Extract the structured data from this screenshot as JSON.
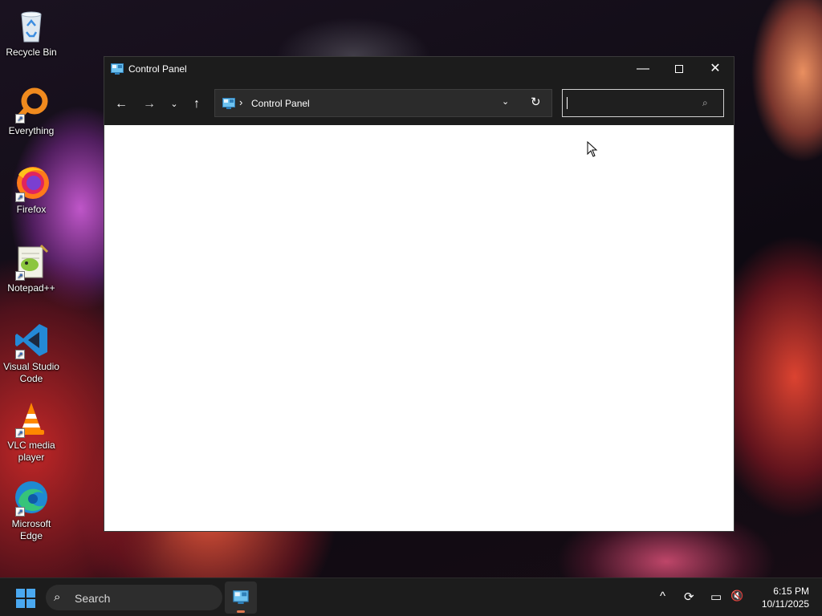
{
  "desktop": {
    "icons": [
      {
        "label": "Recycle Bin",
        "icon": "recycle-bin-icon"
      },
      {
        "label": "Everything",
        "icon": "everything-search-icon"
      },
      {
        "label": "Firefox",
        "icon": "firefox-icon"
      },
      {
        "label": "Notepad++",
        "icon": "notepad-plus-plus-icon"
      },
      {
        "label": "Visual Studio Code",
        "icon": "vscode-icon"
      },
      {
        "label": "VLC media player",
        "icon": "vlc-icon"
      },
      {
        "label": "Microsoft Edge",
        "icon": "edge-icon"
      }
    ]
  },
  "window": {
    "title": "Control Panel",
    "controls": {
      "minimize": "—",
      "maximize": "",
      "close": "✕"
    },
    "nav": {
      "back": "←",
      "forward": "→",
      "recent": "⌄",
      "up": "↑"
    },
    "address": {
      "separator": "›",
      "crumb": "Control Panel",
      "dropdown": "⌄",
      "refresh": "↻"
    },
    "search": {
      "value": "",
      "placeholder": "",
      "icon": "⌕"
    }
  },
  "taskbar": {
    "search_label": "Search",
    "search_icon": "⌕",
    "tray": {
      "chevron": "^",
      "sync": "⟳",
      "network": "▭",
      "volume": "🔇"
    },
    "clock": {
      "time": "6:15 PM",
      "date": "10/11/2025"
    }
  },
  "colors": {
    "accent": "#4aa8f0",
    "window_bg": "#1c1c1c",
    "content_bg": "#ffffff",
    "taskbar_bg": "#1c1c1c"
  }
}
